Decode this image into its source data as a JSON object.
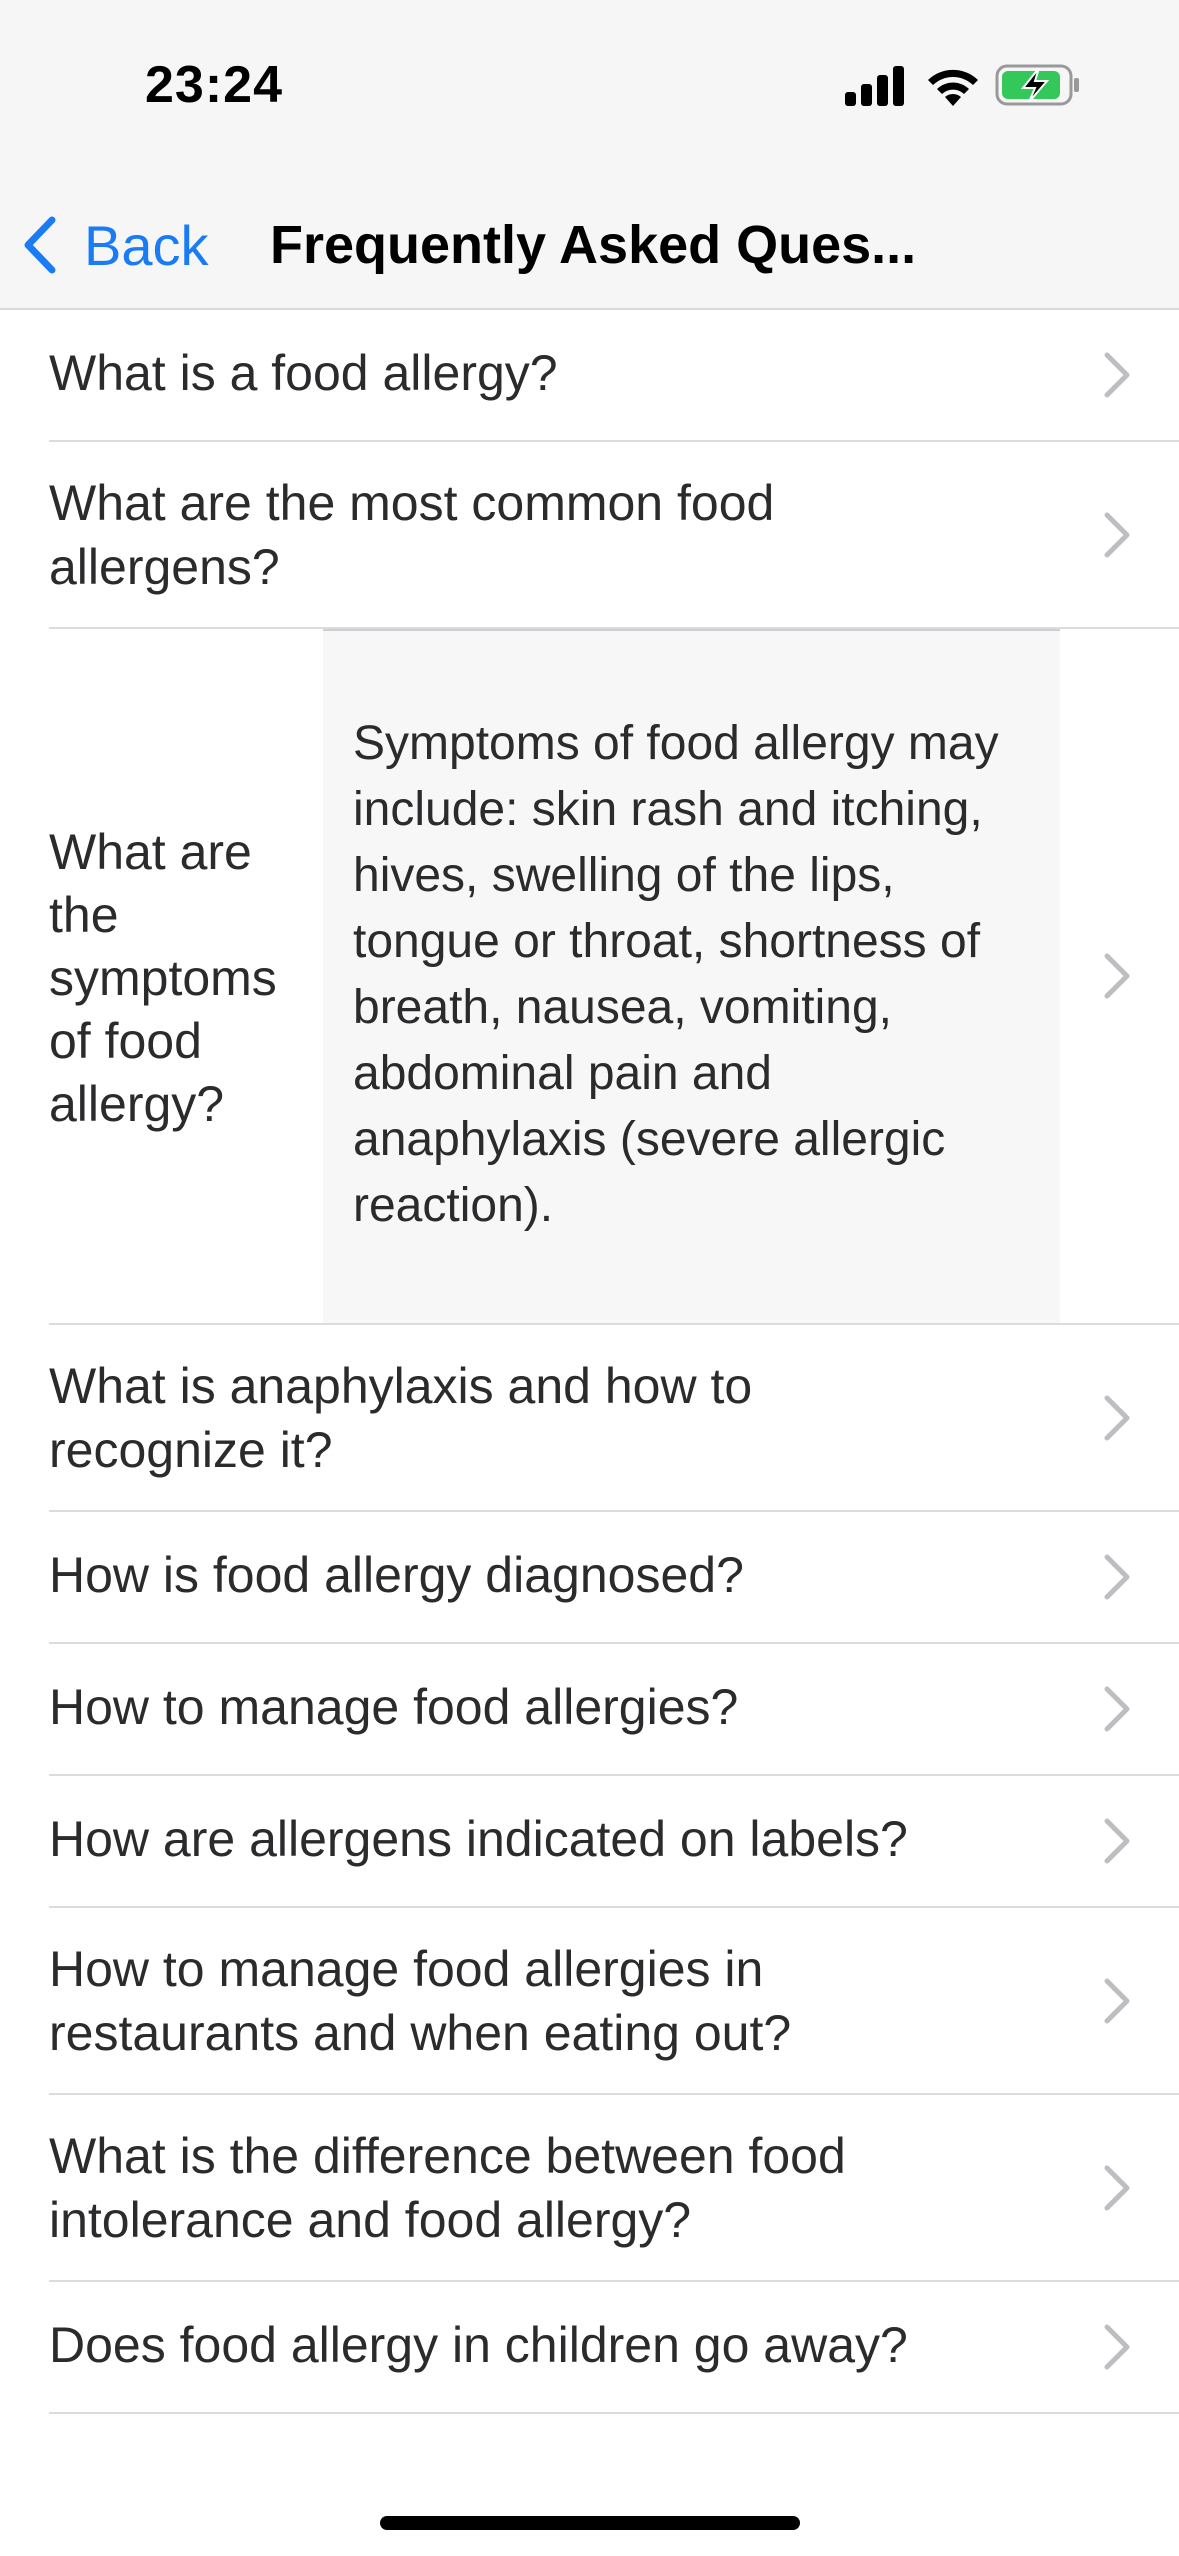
{
  "status_bar": {
    "time": "23:24"
  },
  "nav": {
    "back_label": "Back",
    "title": "Frequently Asked Ques..."
  },
  "faq": {
    "items": [
      {
        "question": "What is a food allergy?"
      },
      {
        "question": "What are the most common food allergens?"
      },
      {
        "question": "What are the symptoms of food allergy?",
        "answer": "Symptoms of food allergy may include: skin rash and itching, hives, swelling of the lips, tongue or throat, shortness of breath, nausea, vomiting, abdominal pain and anaphylaxis (severe allergic reaction).",
        "expanded": true
      },
      {
        "question": "What is anaphylaxis and how to recognize it?"
      },
      {
        "question": "How is food allergy diagnosed?"
      },
      {
        "question": "How to manage food allergies?"
      },
      {
        "question": "How are allergens indicated on labels?"
      },
      {
        "question": "How to manage food allergies in restaurants and when eating out?"
      },
      {
        "question": "What is the difference between food intolerance and food allergy?"
      },
      {
        "question": "Does food allergy in children go away?"
      }
    ]
  },
  "icons": {
    "back": "chevron-left-icon",
    "disclosure": "chevron-right-icon",
    "signal": "cellular-signal-icon",
    "wifi": "wifi-icon",
    "battery": "battery-charging-icon"
  },
  "colors": {
    "accent": "#1a7cf5",
    "battery_green": "#34c759"
  }
}
